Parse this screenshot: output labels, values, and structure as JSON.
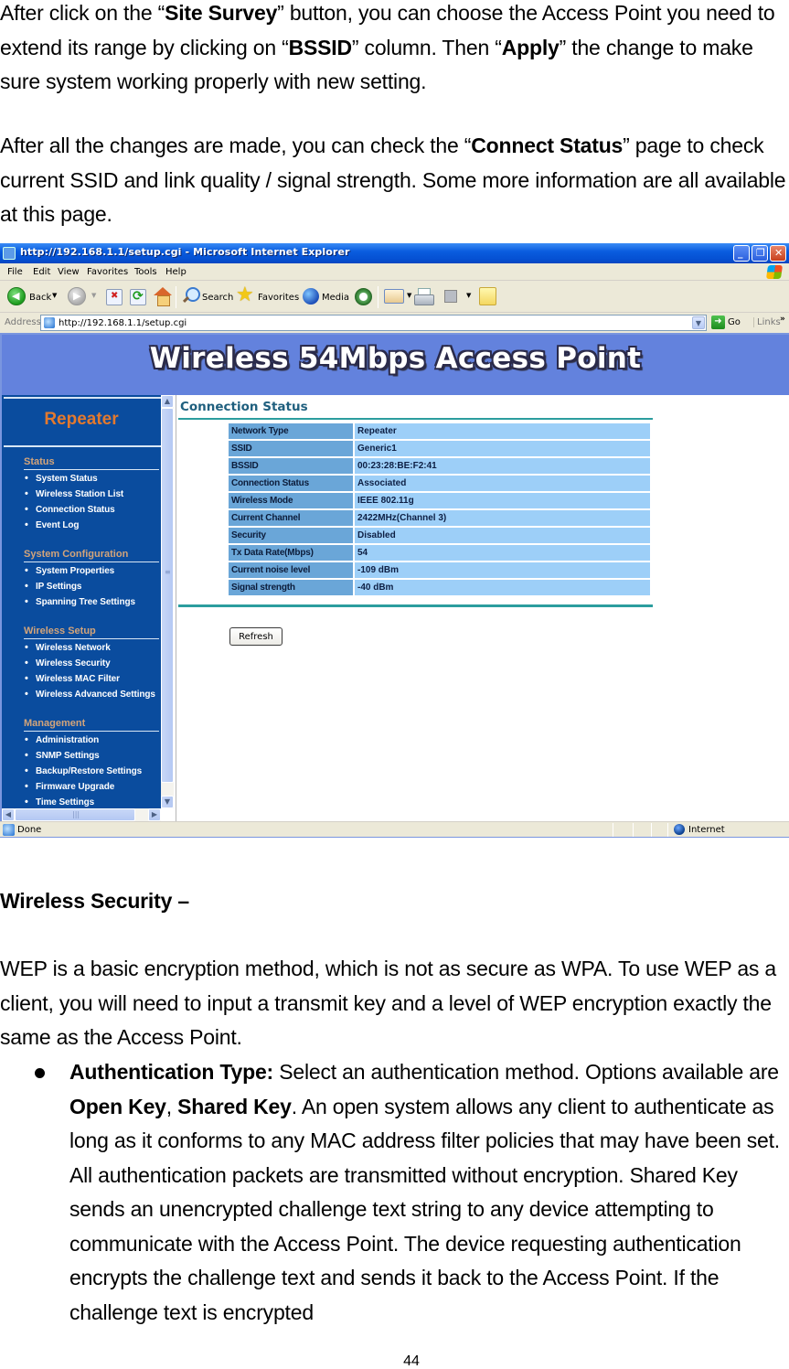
{
  "document": {
    "para1": {
      "t1": "After click on the “",
      "b1": "Site Survey",
      "t2": "” button, you can choose the Access Point you need to extend its range by clicking on “",
      "b2": "BSSID",
      "t3": "” column. Then “",
      "b3": "Apply",
      "t4": "” the change to make sure system working properly with new setting."
    },
    "para2": {
      "t1": "After all the changes are made, you can check the “",
      "b1": "Connect Status",
      "t2": "” page to check current SSID and link quality / signal strength. Some more information are all available at this page."
    },
    "heading": "Wireless Security –",
    "para3": "WEP is a basic encryption method, which is not as secure as WPA. To use WEP as a client, you will need to input a transmit key and a level of WEP encryption exactly the same as the Access Point.",
    "bullet": {
      "label": "Authentication Type:",
      "t1": " Select an authentication method. Options available are ",
      "b1": "Open Key",
      "t2": ", ",
      "b2": "Shared Key",
      "t3": ". An open system allows any client to authenticate as long as it conforms to any MAC address filter policies that may have been set. All authentication packets are transmitted without encryption. Shared Key sends an unencrypted challenge text string to any device attempting to communicate with the Access Point. The device requesting authentication encrypts the challenge text and sends it back to the Access Point. If the challenge text is encrypted"
    },
    "page_number": "44"
  },
  "browser": {
    "title": "http://192.168.1.1/setup.cgi - Microsoft Internet Explorer",
    "window_buttons": {
      "minimize": "_",
      "maximize": "❐",
      "close": "✕"
    },
    "menu": [
      "File",
      "Edit",
      "View",
      "Favorites",
      "Tools",
      "Help"
    ],
    "toolbar": {
      "back": "Back",
      "search": "Search",
      "favorites": "Favorites",
      "media": "Media"
    },
    "address": {
      "label": "Address",
      "url": "http://192.168.1.1/setup.cgi",
      "go": "Go",
      "links": "Links",
      "links_chevron": "»"
    },
    "status": {
      "text": "Done",
      "zone": "Internet"
    }
  },
  "app": {
    "banner": "Wireless 54Mbps Access Point",
    "mode": "Repeater",
    "sidebar": {
      "sections": [
        {
          "title": "Status",
          "items": [
            "System Status",
            "Wireless Station List",
            "Connection Status",
            "Event Log"
          ]
        },
        {
          "title": "System Configuration",
          "items": [
            "System Properties",
            "IP Settings",
            "Spanning Tree Settings"
          ]
        },
        {
          "title": "Wireless Setup",
          "items": [
            "Wireless Network",
            "Wireless Security",
            "Wireless MAC Filter",
            "Wireless Advanced Settings"
          ]
        },
        {
          "title": "Management",
          "items": [
            "Administration",
            "SNMP Settings",
            "Backup/Restore Settings",
            "Firmware Upgrade",
            "Time Settings"
          ]
        }
      ]
    },
    "main": {
      "title": "Connection Status",
      "rows": [
        {
          "key": "Network Type",
          "value": "Repeater"
        },
        {
          "key": "SSID",
          "value": "Generic1"
        },
        {
          "key": "BSSID",
          "value": "00:23:28:BE:F2:41"
        },
        {
          "key": "Connection Status",
          "value": "Associated"
        },
        {
          "key": "Wireless Mode",
          "value": "IEEE 802.11g"
        },
        {
          "key": "Current Channel",
          "value": "2422MHz(Channel 3)"
        },
        {
          "key": "Security",
          "value": "Disabled"
        },
        {
          "key": "Tx Data Rate(Mbps)",
          "value": "54"
        },
        {
          "key": "Current noise level",
          "value": "-109 dBm"
        },
        {
          "key": "Signal strength",
          "value": "-40 dBm"
        }
      ],
      "refresh_label": "Refresh"
    }
  },
  "colors": {
    "banner_bg": "#6382dd",
    "sidebar_bg": "#0a4c9e",
    "mode_text": "#e3792e",
    "section_text": "#d3a47a",
    "table_key_bg": "#6aa6d8",
    "table_value_bg": "#9dcff8",
    "rule_teal": "#2c9d9e"
  }
}
